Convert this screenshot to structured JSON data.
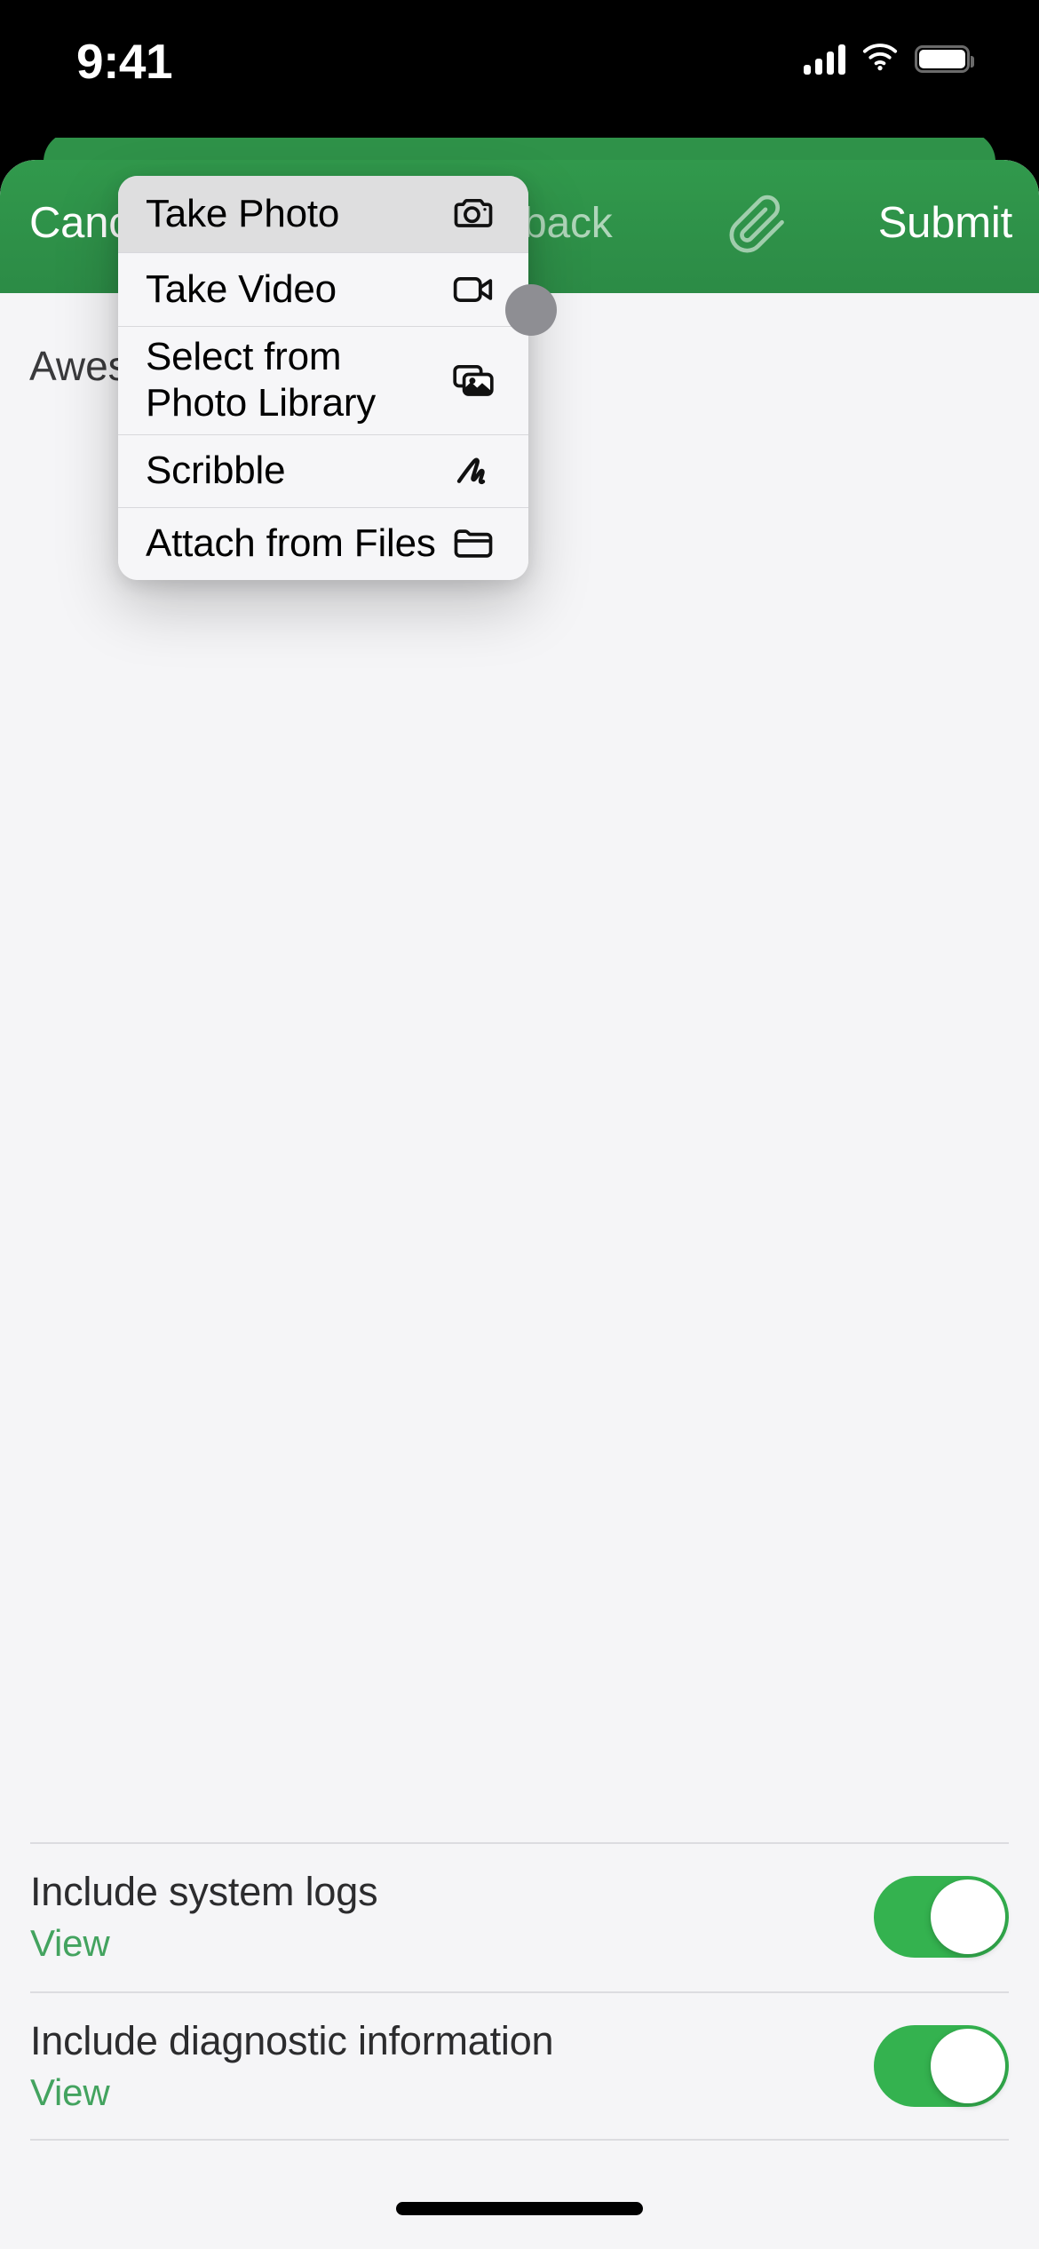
{
  "status_bar": {
    "time": "9:41",
    "signal_icon": "cellular-bars-icon",
    "wifi_icon": "wifi-icon",
    "battery_icon": "battery-full-icon"
  },
  "navbar": {
    "cancel_label": "Cancel",
    "title": "Feedback",
    "attach_icon": "paperclip-icon",
    "submit_label": "Submit",
    "background_color": "#2e914a",
    "title_color": "rgba(255,255,255,0.62)"
  },
  "content": {
    "body_text": "Awesome"
  },
  "attach_menu": {
    "items": [
      {
        "label": "Take Photo",
        "icon": "camera-icon",
        "selected": true
      },
      {
        "label": "Take Video",
        "icon": "video-camera-icon",
        "selected": false
      },
      {
        "label": "Select from\nPhoto Library",
        "icon": "photo-stack-icon",
        "selected": false
      },
      {
        "label": "Scribble",
        "icon": "scribble-icon",
        "selected": false
      },
      {
        "label": "Attach from Files",
        "icon": "folder-icon",
        "selected": false
      }
    ],
    "selected_background": "#dededf",
    "background": "#f6f6f8"
  },
  "touch_indicator": {
    "name": "touch-point",
    "color": "#8e8e93"
  },
  "options": [
    {
      "title": "Include system logs",
      "link_label": "View",
      "toggle_on": true,
      "toggle_color": "#34b24f"
    },
    {
      "title": "Include diagnostic information",
      "link_label": "View",
      "toggle_on": true,
      "toggle_color": "#34b24f"
    }
  ],
  "home_indicator": {
    "name": "home-indicator"
  }
}
